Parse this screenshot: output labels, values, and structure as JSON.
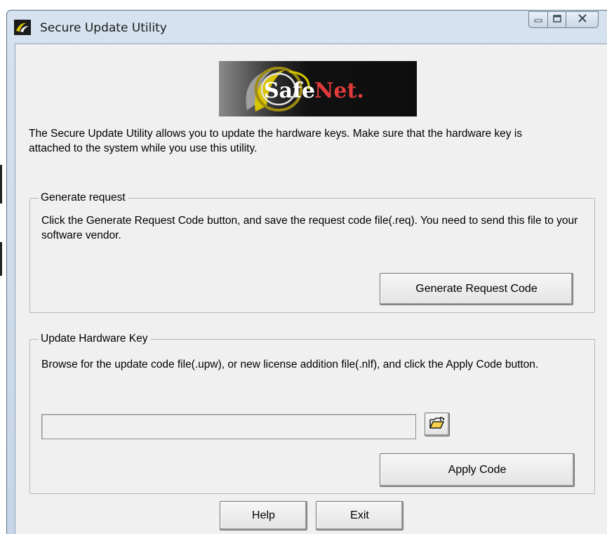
{
  "window": {
    "title": "Secure Update Utility"
  },
  "logo": {
    "brand": "SafeNet.",
    "icon": "safenet-logo"
  },
  "intro": {
    "text": "The Secure Update Utility allows you to update the hardware keys. Make sure that the hardware key is attached to the system while you use this utility."
  },
  "generate": {
    "legend": "Generate request",
    "description": "Click the Generate Request Code button, and save the request code file(.req). You need to send this file to your software vendor.",
    "button": "Generate Request Code"
  },
  "update": {
    "legend": "Update Hardware Key",
    "description": "Browse for the update code file(.upw), or new license addition file(.nlf), and click the Apply Code button.",
    "file_path": "",
    "browse_icon": "folder-open-icon",
    "button": "Apply Code"
  },
  "footer": {
    "help": "Help",
    "exit": "Exit"
  },
  "colors": {
    "title_bar": "#c6d6e8",
    "client": "#f0f0f0",
    "logo_red": "#e03a3a"
  }
}
